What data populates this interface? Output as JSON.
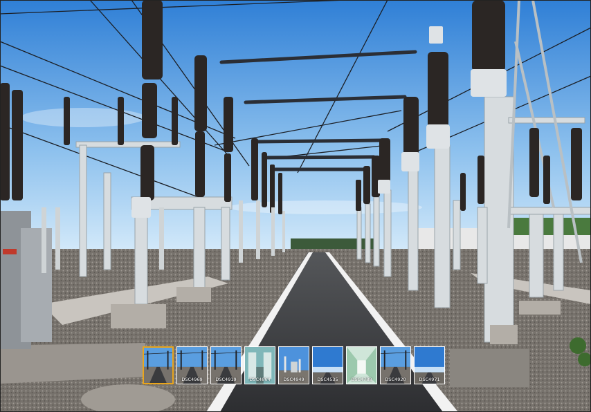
{
  "viewer": {
    "scene_description_icon": "substation-panorama"
  },
  "thumbnails": [
    {
      "label": "",
      "active": true,
      "variant": "road"
    },
    {
      "label": "DSC4969",
      "active": false,
      "variant": "road"
    },
    {
      "label": "DSC4919",
      "active": false,
      "variant": "road"
    },
    {
      "label": "DSC4864",
      "active": false,
      "variant": "indoor"
    },
    {
      "label": "DSC4949",
      "active": false,
      "variant": "yard"
    },
    {
      "label": "DSC4535",
      "active": false,
      "variant": "sky"
    },
    {
      "label": "DSC4788",
      "active": false,
      "variant": "corridor"
    },
    {
      "label": "DSC4920",
      "active": false,
      "variant": "road"
    },
    {
      "label": "DSC4971",
      "active": false,
      "variant": "sky"
    }
  ],
  "colors": {
    "active_border": "#e9a51c",
    "sky_top": "#2f7fd6",
    "sky_bottom": "#cfe6f8",
    "gravel": "#6d6a66",
    "road": "#3a3b3e"
  }
}
